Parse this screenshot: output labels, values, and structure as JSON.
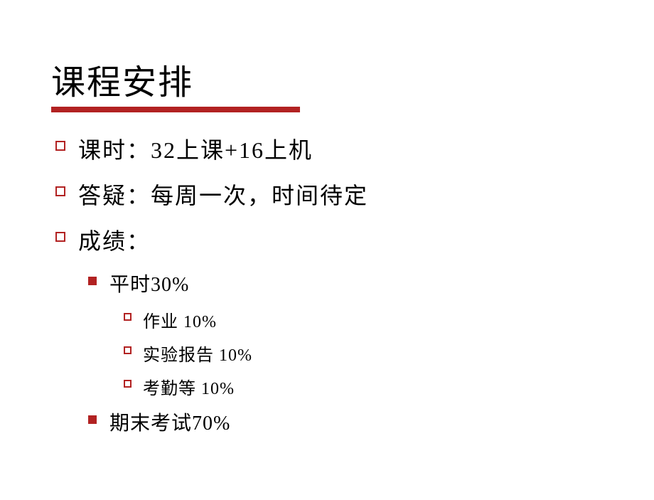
{
  "title": "课程安排",
  "items": [
    {
      "level": 1,
      "text": "课时：32上课+16上机"
    },
    {
      "level": 1,
      "text": "答疑：每周一次，时间待定"
    },
    {
      "level": 1,
      "text": "成绩："
    },
    {
      "level": 2,
      "text": "平时30%"
    },
    {
      "level": 3,
      "text": "作业 10%"
    },
    {
      "level": 3,
      "text": "实验报告 10%"
    },
    {
      "level": 3,
      "text": "考勤等 10%"
    },
    {
      "level": 2,
      "text": "期末考试70%"
    }
  ]
}
